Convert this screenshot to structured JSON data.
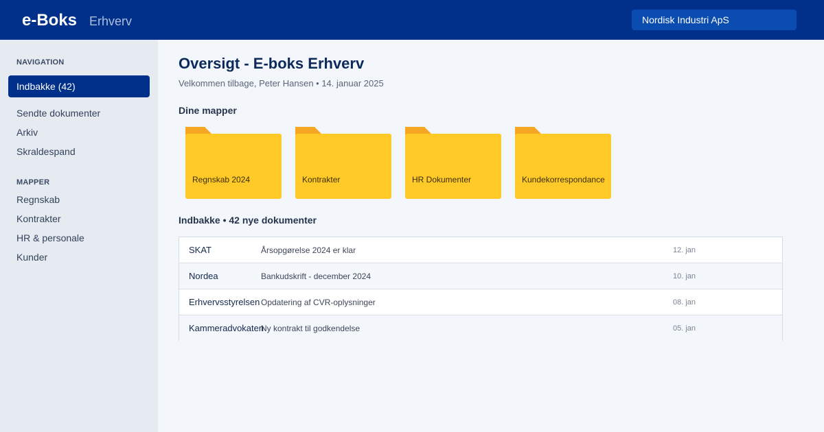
{
  "header": {
    "brand": "e-Boks",
    "brand_sub": "Erhverv",
    "company": "Nordisk Industri ApS"
  },
  "sidebar": {
    "nav_heading": "NAVIGATION",
    "nav_items": [
      {
        "label": "Indbakke (42)",
        "active": true
      },
      {
        "label": "Sendte dokumenter"
      },
      {
        "label": "Arkiv"
      },
      {
        "label": "Skraldespand"
      }
    ],
    "folders_heading": "MAPPER",
    "folder_items": [
      "Regnskab",
      "Kontrakter",
      "HR & personale",
      "Kunder"
    ]
  },
  "main": {
    "title": "Oversigt - E-boks Erhverv",
    "subtitle": "Velkommen tilbage, Peter Hansen • 14. januar 2025",
    "folders_title": "Dine mapper",
    "folders": [
      "Regnskab 2024",
      "Kontrakter",
      "HR Dokumenter",
      "Kundekorrespondance"
    ],
    "inbox_title": "Indbakke • 42 nye dokumenter",
    "inbox": [
      {
        "sender": "SKAT",
        "subject": "Årsopgørelse 2024 er klar",
        "date": "12. jan"
      },
      {
        "sender": "Nordea",
        "subject": "Bankudskrift - december 2024",
        "date": "10. jan"
      },
      {
        "sender": "Erhvervsstyrelsen",
        "subject": "Opdatering af CVR-oplysninger",
        "date": "08. jan"
      },
      {
        "sender": "Kammeradvokaten",
        "subject": "Ny kontrakt til godkendelse",
        "date": "05. jan"
      }
    ]
  },
  "colors": {
    "primary": "#00308a",
    "folder": "#ffca28",
    "folder_tab": "#f5a623",
    "background": "#f3f6fa",
    "sidebar": "#e6ebf2"
  }
}
